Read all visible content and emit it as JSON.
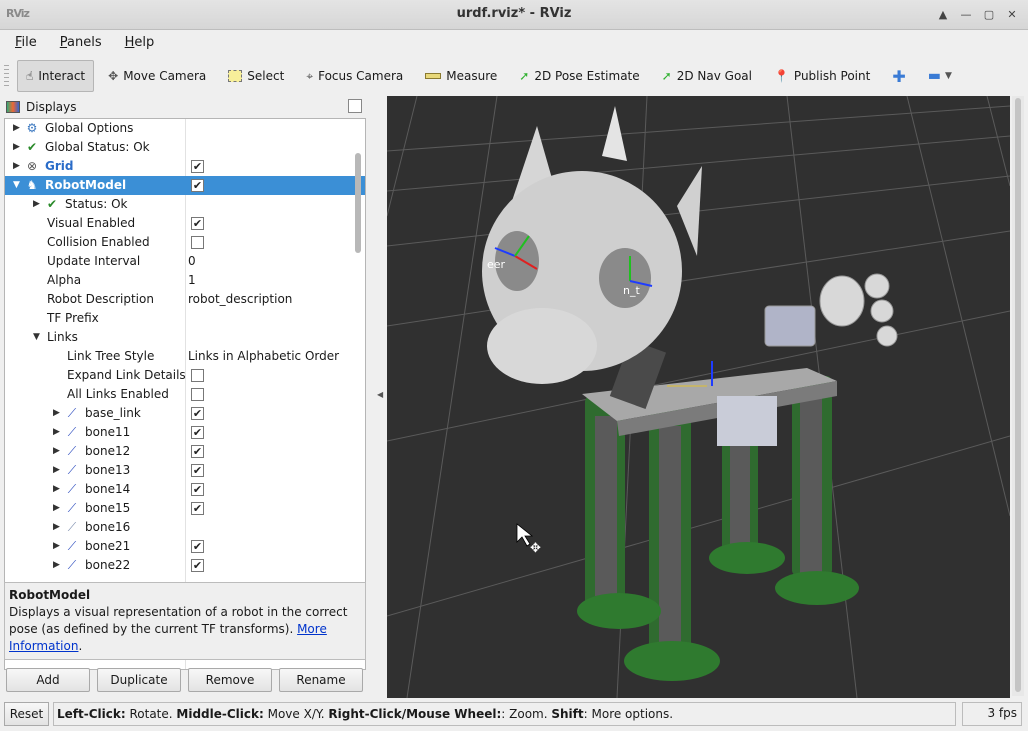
{
  "window": {
    "title": "urdf.rviz* - RViz",
    "logo": "RViz",
    "buttons": [
      "up-icon",
      "minimize-icon",
      "maximize-icon",
      "close-icon"
    ]
  },
  "menu": [
    {
      "label": "File",
      "mnemonic": "F",
      "rest": "ile"
    },
    {
      "label": "Panels",
      "mnemonic": "P",
      "rest": "anels"
    },
    {
      "label": "Help",
      "mnemonic": "H",
      "rest": "elp"
    }
  ],
  "toolbar": [
    {
      "id": "interact",
      "label": "Interact",
      "icon": "hand-icon"
    },
    {
      "id": "move-camera",
      "label": "Move Camera",
      "icon": "move-icon"
    },
    {
      "id": "select",
      "label": "Select",
      "icon": "select-box-icon"
    },
    {
      "id": "focus-camera",
      "label": "Focus Camera",
      "icon": "crosshair-icon"
    },
    {
      "id": "measure",
      "label": "Measure",
      "icon": "ruler-icon"
    },
    {
      "id": "pose-estimate",
      "label": "2D Pose Estimate",
      "icon": "green-arrow-icon"
    },
    {
      "id": "nav-goal",
      "label": "2D Nav Goal",
      "icon": "green-arrow-icon"
    },
    {
      "id": "publish-point",
      "label": "Publish Point",
      "icon": "map-pin-icon"
    }
  ],
  "displays": {
    "title": "Displays",
    "rows": [
      {
        "label": "Global Options",
        "icon": "⚙",
        "iconColor": "#3b78c0",
        "arrow": "▶",
        "indent": 0
      },
      {
        "label": "Global Status: Ok",
        "icon": "✔",
        "iconColor": "#2a8a2a",
        "arrow": "▶",
        "indent": 0
      },
      {
        "label": "Grid",
        "icon": "⊗",
        "iconColor": "#555",
        "arrow": "▶",
        "indent": 0,
        "check": true,
        "blue": true
      },
      {
        "label": "RobotModel",
        "icon": "♞",
        "iconColor": "#3b5fa0",
        "arrow": "▼",
        "indent": 0,
        "check": true,
        "selected": true
      },
      {
        "label": "Status: Ok",
        "icon": "✔",
        "iconColor": "#2a8a2a",
        "arrow": "▶",
        "indent": 1
      },
      {
        "label": "Visual Enabled",
        "indent": 1,
        "check": true,
        "noicon": true
      },
      {
        "label": "Collision Enabled",
        "indent": 1,
        "check": false,
        "noicon": true
      },
      {
        "label": "Update Interval",
        "indent": 1,
        "value": "0",
        "noicon": true
      },
      {
        "label": "Alpha",
        "indent": 1,
        "value": "1",
        "noicon": true
      },
      {
        "label": "Robot Description",
        "indent": 1,
        "value": "robot_description",
        "noicon": true
      },
      {
        "label": "TF Prefix",
        "indent": 1,
        "value": "",
        "noicon": true
      },
      {
        "label": "Links",
        "arrow": "▼",
        "indent": 1,
        "noicon": true,
        "links": true
      },
      {
        "label": "Link Tree Style",
        "indent": 2,
        "value": "Links in Alphabetic Order",
        "noicon": true
      },
      {
        "label": "Expand Link Details",
        "indent": 2,
        "check": false,
        "noicon": true
      },
      {
        "label": "All Links Enabled",
        "indent": 2,
        "check": false,
        "noicon": true
      },
      {
        "label": "base_link",
        "icon": "⟋",
        "iconColor": "#3050c0",
        "arrow": "▶",
        "indent": 2,
        "check": true
      },
      {
        "label": "bone11",
        "icon": "⟋",
        "iconColor": "#3050c0",
        "arrow": "▶",
        "indent": 2,
        "check": true
      },
      {
        "label": "bone12",
        "icon": "⟋",
        "iconColor": "#3050c0",
        "arrow": "▶",
        "indent": 2,
        "check": true
      },
      {
        "label": "bone13",
        "icon": "⟋",
        "iconColor": "#3050c0",
        "arrow": "▶",
        "indent": 2,
        "check": true
      },
      {
        "label": "bone14",
        "icon": "⟋",
        "iconColor": "#3050c0",
        "arrow": "▶",
        "indent": 2,
        "check": true
      },
      {
        "label": "bone15",
        "icon": "⟋",
        "iconColor": "#3050c0",
        "arrow": "▶",
        "indent": 2,
        "check": true
      },
      {
        "label": "bone16",
        "icon": "⟋",
        "iconColor": "#8090b0",
        "arrow": "▶",
        "indent": 2
      },
      {
        "label": "bone21",
        "icon": "⟋",
        "iconColor": "#3050c0",
        "arrow": "▶",
        "indent": 2,
        "check": true
      },
      {
        "label": "bone22",
        "icon": "⟋",
        "iconColor": "#3050c0",
        "arrow": "▶",
        "indent": 2,
        "check": true
      }
    ]
  },
  "description": {
    "title": "RobotModel",
    "text": "Displays a visual representation of a robot in the correct pose (as defined by the current TF transforms). ",
    "link": "More Information",
    "after": "."
  },
  "panel_buttons": [
    "Add",
    "Duplicate",
    "Remove",
    "Rename"
  ],
  "view": {
    "frame_labels": [
      "base_link",
      "..._link"
    ]
  },
  "status": {
    "reset": "Reset",
    "hints": [
      {
        "b": "Left-Click:",
        "t": " Rotate. "
      },
      {
        "b": "Middle-Click:",
        "t": " Move X/Y. "
      },
      {
        "b": "Right-Click/Mouse Wheel:",
        "t": ": Zoom. "
      },
      {
        "b": "Shift",
        "t": ": More options."
      }
    ],
    "fps": "3 fps"
  }
}
